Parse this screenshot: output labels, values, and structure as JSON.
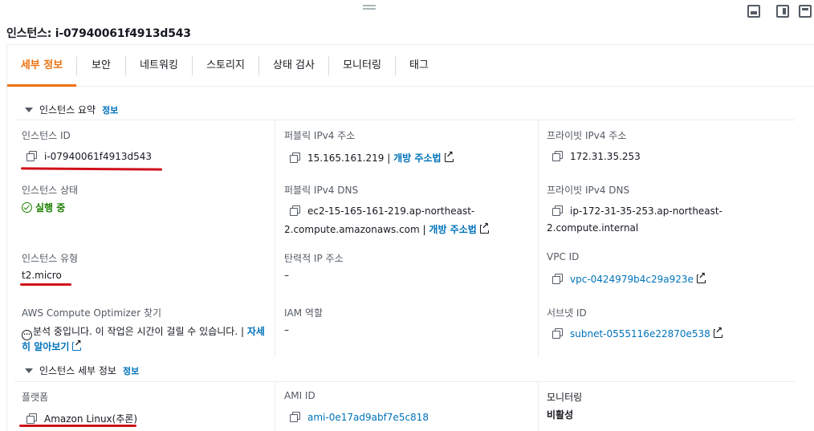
{
  "title": "인스턴스: i-07940061f4913d543",
  "tabs": [
    {
      "label": "세부 정보",
      "active": true
    },
    {
      "label": "보안"
    },
    {
      "label": "네트워킹"
    },
    {
      "label": "스토리지"
    },
    {
      "label": "상태 검사"
    },
    {
      "label": "모니터링"
    },
    {
      "label": "태그"
    }
  ],
  "summary": {
    "header": "인스턴스 요약",
    "info": "정보",
    "instance_id": {
      "label": "인스턴스 ID",
      "value": "i-07940061f4913d543"
    },
    "public_ipv4": {
      "label": "퍼블릭 IPv4 주소",
      "value": "15.165.161.219",
      "sep": "|",
      "open": "개방 주소법"
    },
    "private_ipv4": {
      "label": "프라이빗 IPv4 주소",
      "value": "172.31.35.253"
    },
    "state": {
      "label": "인스턴스 상태",
      "value": "실행 중"
    },
    "public_dns": {
      "label": "퍼블릭 IPv4 DNS",
      "value_line1": "ec2-15-165-161-219.ap-northeast-",
      "value_line2": "2.compute.amazonaws.com",
      "sep": "|",
      "open": "개방 주소법"
    },
    "private_dns": {
      "label": "프라이빗 IPv4 DNS",
      "value_line1": "ip-172-31-35-253.ap-northeast-",
      "value_line2": "2.compute.internal"
    },
    "type": {
      "label": "인스턴스 유형",
      "value": "t2.micro"
    },
    "elastic_ip": {
      "label": "탄력적 IP 주소",
      "value": "–"
    },
    "vpc": {
      "label": "VPC ID",
      "value": "vpc-0424979b4c29a923e"
    },
    "optimizer": {
      "label": "AWS Compute Optimizer 찾기",
      "text": "분석 중입니다. 이 작업은 시간이 걸릴 수 있습니다. |",
      "link1": "자세",
      "link2": "히 알아보기"
    },
    "iam": {
      "label": "IAM 역할",
      "value": "–"
    },
    "subnet": {
      "label": "서브넷 ID",
      "value": "subnet-0555116e22870e538"
    }
  },
  "details": {
    "header": "인스턴스 세부 정보",
    "info": "정보",
    "platform": {
      "label": "플랫폼",
      "value": "Amazon Linux(추론)"
    },
    "ami": {
      "label": "AMI ID",
      "value": "ami-0e17ad9abf7e5c818"
    },
    "monitoring": {
      "label": "모니터링",
      "value": "비활성"
    }
  },
  "colors": {
    "accent": "#ec7211",
    "link": "#0073bb",
    "success": "#1d8102",
    "annotation": "#d0101a"
  }
}
